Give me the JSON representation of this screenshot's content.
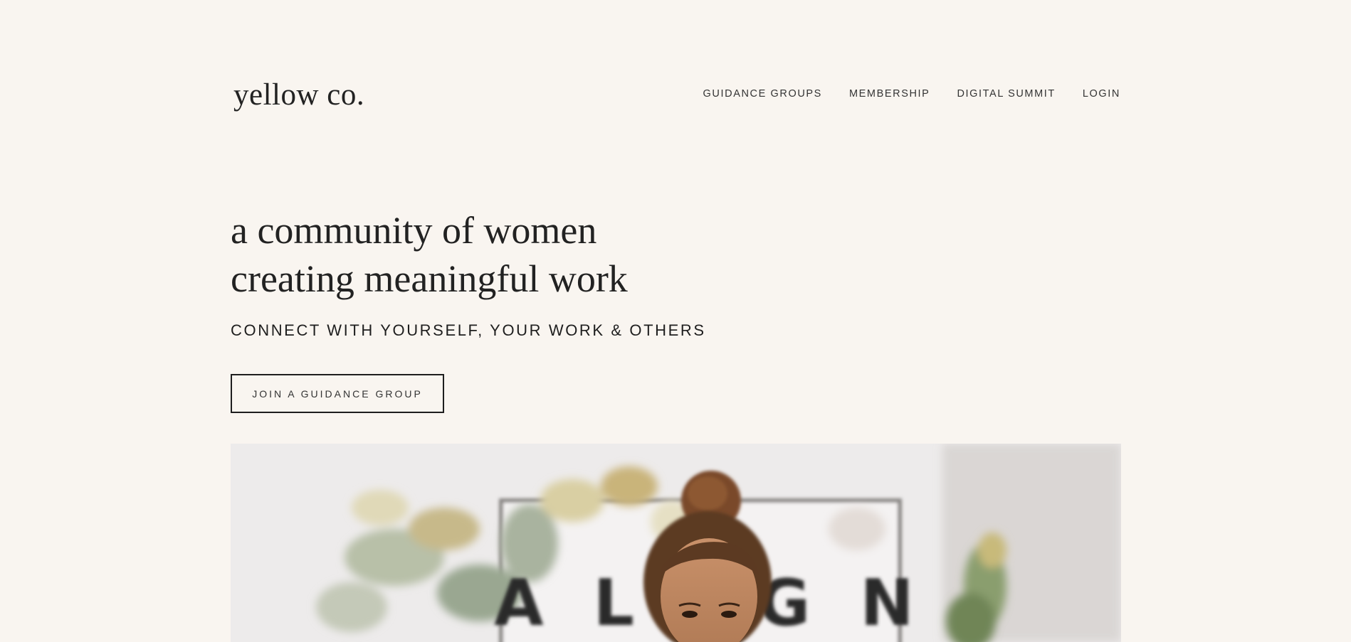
{
  "header": {
    "logo": "yellow co.",
    "nav": [
      {
        "label": "GUIDANCE GROUPS"
      },
      {
        "label": "MEMBERSHIP"
      },
      {
        "label": "DIGITAL SUMMIT"
      },
      {
        "label": "LOGIN"
      }
    ]
  },
  "hero": {
    "headline_line1": "a community of women",
    "headline_line2": "creating meaningful work",
    "subheadline": "CONNECT WITH YOURSELF, YOUR WORK & OTHERS",
    "cta_label": "JOIN A GUIDANCE GROUP",
    "photo_sign_text": "ALIGN"
  },
  "colors": {
    "background": "#f9f5f0",
    "text": "#222222",
    "button_border": "#1e1e1e"
  }
}
